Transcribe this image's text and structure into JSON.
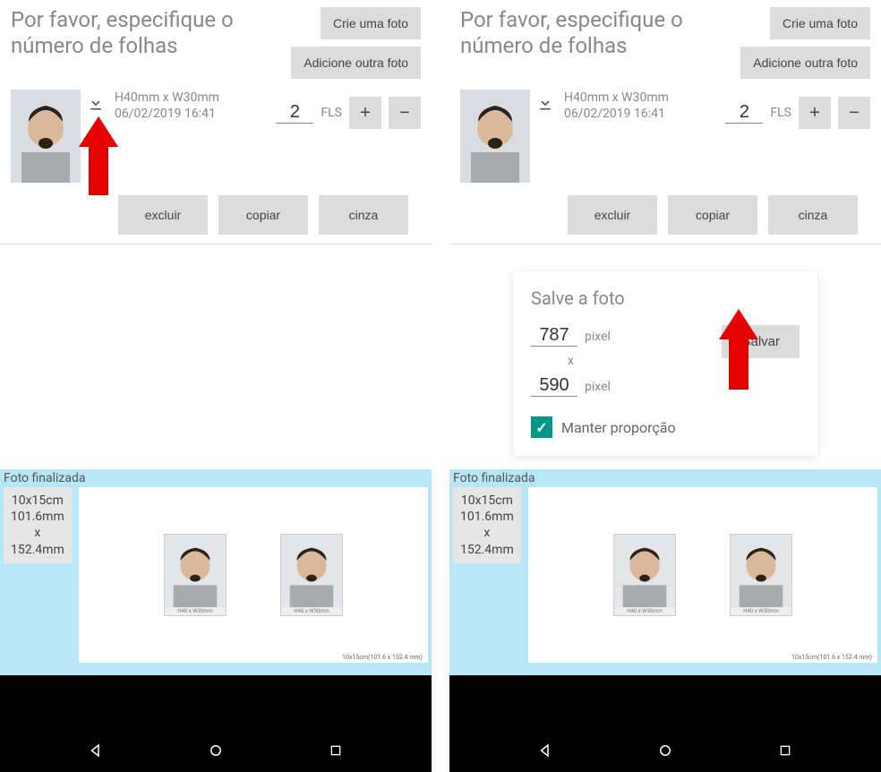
{
  "left": {
    "title": "Por favor, especifique o número de folhas",
    "buttons": {
      "create_photo": "Crie uma foto",
      "add_photo": "Adicione outra foto",
      "delete": "excluir",
      "copy": "copiar",
      "gray": "cinza",
      "plus": "+",
      "minus": "−"
    },
    "photo": {
      "dimensions": "H40mm x W30mm",
      "timestamp": "06/02/2019 16:41"
    },
    "sheets": {
      "value": "2",
      "unit": "FLS"
    },
    "preview": {
      "label": "Foto finalizada",
      "size_line1": "10x15cm",
      "size_line2": "101.6mm",
      "size_line3": "x",
      "size_line4": "152.4mm",
      "mini_caption": "H40 x W30mm",
      "sheet_caption": "10x15cm(101.6 x 152.4 mm)"
    }
  },
  "right": {
    "title": "Por favor, especifique o número de folhas",
    "buttons": {
      "create_photo": "Crie uma foto",
      "add_photo": "Adicione outra foto",
      "delete": "excluir",
      "copy": "copiar",
      "gray": "cinza",
      "plus": "+",
      "minus": "−"
    },
    "photo": {
      "dimensions": "H40mm x W30mm",
      "timestamp": "06/02/2019 16:41"
    },
    "sheets": {
      "value": "2",
      "unit": "FLS"
    },
    "save_card": {
      "title": "Salve a foto",
      "width_value": "787",
      "height_value": "590",
      "pixel_label": "pixel",
      "x_label": "x",
      "save_btn": "Salvar",
      "proportion_label": "Manter proporção"
    },
    "preview": {
      "label": "Foto finalizada",
      "size_line1": "10x15cm",
      "size_line2": "101.6mm",
      "size_line3": "x",
      "size_line4": "152.4mm",
      "mini_caption": "H40 x W30mm",
      "sheet_caption": "10x15cm(101.6 x 152.4 mm)"
    }
  }
}
